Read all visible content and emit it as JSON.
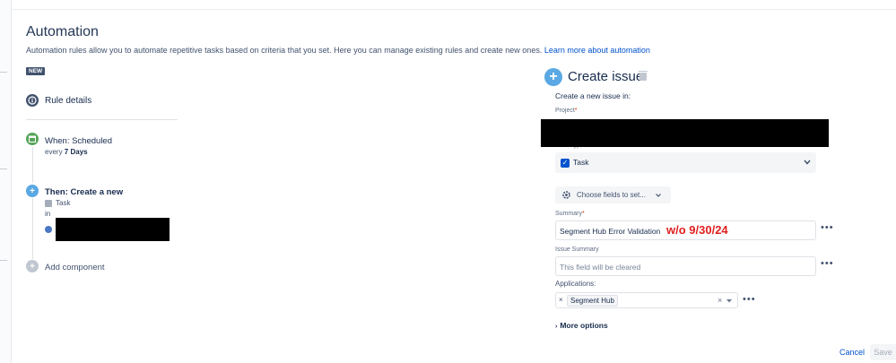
{
  "page": {
    "title": "Automation",
    "description": "Automation rules allow you to automate repetitive tasks based on criteria that you set. Here you can manage existing rules and create new ones.",
    "learn_more": "Learn more about automation",
    "badge": "NEW"
  },
  "rule": {
    "details_label": "Rule details",
    "trigger_label": "When: Scheduled",
    "trigger_sub_prefix": "every ",
    "trigger_sub_value": "7 Days",
    "action_label": "Then: Create a new",
    "action_item": "Task",
    "action_in": "in",
    "add_component": "Add component"
  },
  "editor": {
    "title": "Create issue",
    "subtitle": "Create a new issue in:",
    "project_label": "Project",
    "issue_type_label": "Issue type",
    "issue_type_value": "Task",
    "choose_fields": "Choose fields to set...",
    "summary_label": "Summary",
    "summary_value": "Segment Hub Error Validation",
    "annotation": "w/o 9/30/24",
    "issue_summary_label": "Issue Summary",
    "issue_summary_placeholder": "This field will be cleared",
    "applications_label": "Applications:",
    "application_chip": "Segment Hub",
    "more_options": "More options",
    "cancel": "Cancel",
    "save": "Save",
    "required_mark": "*"
  },
  "colors": {
    "accent": "#0052cc",
    "annotation": "#e02020",
    "trigger": "#57a55a",
    "action": "#5aa8e4"
  },
  "icons": {
    "info": "info-icon",
    "calendar": "calendar-icon",
    "plus": "plus-icon",
    "gear": "gear-icon",
    "chevron": "chevron-down-icon",
    "trash": "trash-icon"
  }
}
